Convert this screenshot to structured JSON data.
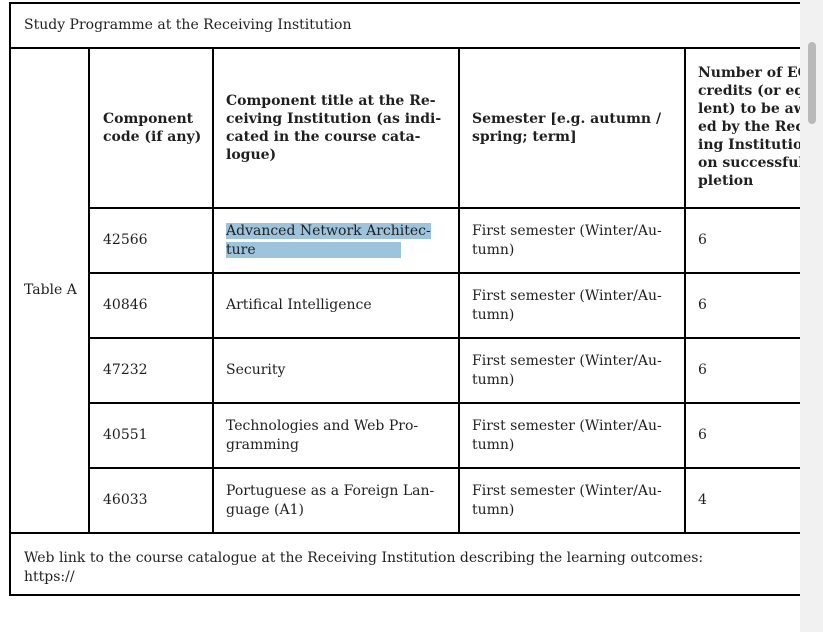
{
  "title": "Study Programme at the Receiving Institution",
  "table_label": "Table A",
  "headers": {
    "code": [
      "Component",
      "code (if any)"
    ],
    "title": [
      "Component title at the Re-",
      "ceiving Institution (as indi-",
      "cated in the course cata-",
      "logue)"
    ],
    "semester": [
      "Semester [e.g. autumn /",
      "spring; term]"
    ],
    "credits": [
      "Number of EC",
      "credits (or eq",
      "lent) to be aw",
      "ed by the Rec",
      "ing Institution",
      "on successful",
      "pletion"
    ]
  },
  "rows": [
    {
      "code": "42566",
      "title": [
        "Advanced Network Architec-",
        "ture"
      ],
      "semester": [
        "First semester (Winter/Au-",
        "tumn)"
      ],
      "credits": "6"
    },
    {
      "code": "40846",
      "title": [
        "Artifical Intelligence"
      ],
      "semester": [
        "First semester (Winter/Au-",
        "tumn)"
      ],
      "credits": "6"
    },
    {
      "code": "47232",
      "title": [
        "Security"
      ],
      "semester": [
        "First semester (Winter/Au-",
        "tumn)"
      ],
      "credits": "6"
    },
    {
      "code": "40551",
      "title": [
        "Technologies and Web Pro-",
        "gramming"
      ],
      "semester": [
        "First semester (Winter/Au-",
        "tumn)"
      ],
      "credits": "6"
    },
    {
      "code": "46033",
      "title": [
        "Portuguese as a Foreign Lan-",
        "guage (A1)"
      ],
      "semester": [
        "First semester (Winter/Au-",
        "tumn)"
      ],
      "credits": "4"
    }
  ],
  "footer": [
    "Web link to the course catalogue at the Receiving Institution describing the learning outcomes:",
    "https://"
  ],
  "colors": {
    "selection": "#9ec3dc",
    "border": "#000000"
  }
}
